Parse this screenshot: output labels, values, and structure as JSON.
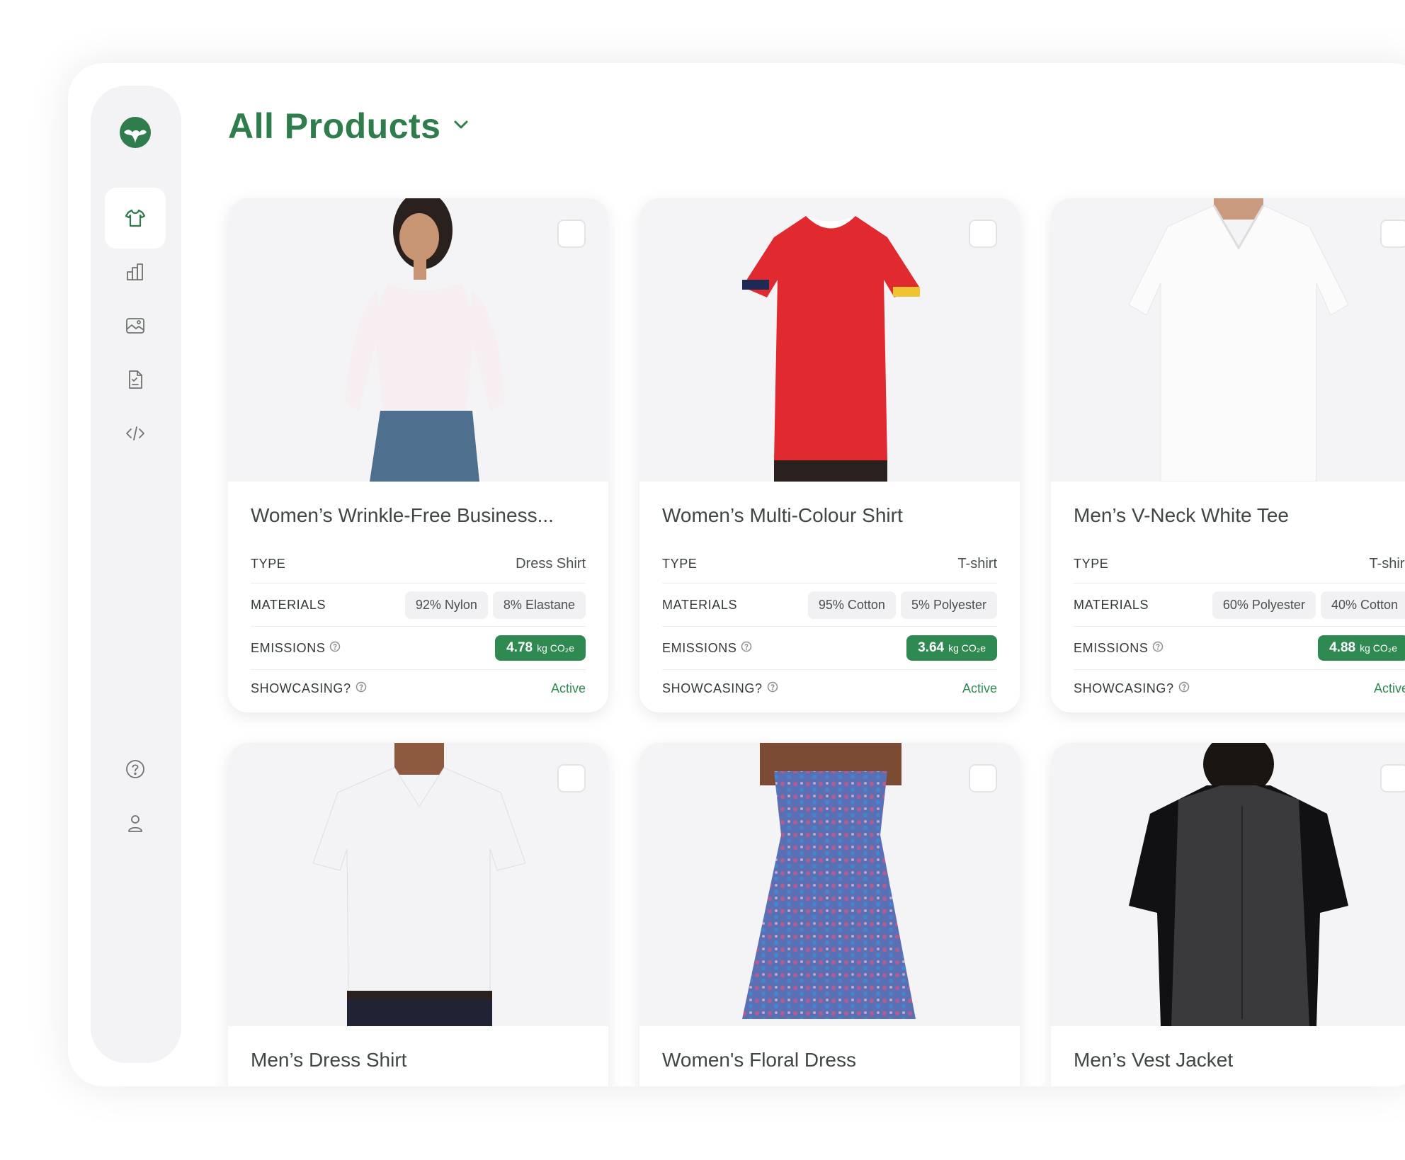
{
  "page": {
    "title": "All Products"
  },
  "sidebar": {
    "items": [
      {
        "name": "products",
        "icon": "tshirt-icon",
        "active": true
      },
      {
        "name": "analytics",
        "icon": "bar-chart-icon",
        "active": false
      },
      {
        "name": "media",
        "icon": "image-icon",
        "active": false
      },
      {
        "name": "reports",
        "icon": "document-icon",
        "active": false
      },
      {
        "name": "developer",
        "icon": "code-icon",
        "active": false
      }
    ],
    "bottom_items": [
      {
        "name": "help",
        "icon": "help-icon"
      },
      {
        "name": "account",
        "icon": "user-icon"
      }
    ]
  },
  "labels": {
    "type": "TYPE",
    "materials": "MATERIALS",
    "emissions": "EMISSIONS",
    "showcasing": "SHOWCASING?"
  },
  "colors": {
    "accent": "#2f7d4d",
    "badge": "#2f8a52",
    "card_bg": "#f4f4f6"
  },
  "products": [
    {
      "name": "Women’s Wrinkle-Free Business...",
      "type": "Dress Shirt",
      "materials": [
        "92% Nylon",
        "8% Elastane"
      ],
      "emissions_value": "4.78",
      "emissions_unit": "kg CO₂e",
      "showcasing": "Active"
    },
    {
      "name": "Women’s Multi-Colour Shirt",
      "type": "T-shirt",
      "materials": [
        "95% Cotton",
        "5% Polyester"
      ],
      "emissions_value": "3.64",
      "emissions_unit": "kg CO₂e",
      "showcasing": "Active"
    },
    {
      "name": "Men’s V-Neck White Tee",
      "type": "T-shirt",
      "materials": [
        "60% Polyester",
        "40% Cotton"
      ],
      "emissions_value": "4.88",
      "emissions_unit": "kg CO₂e",
      "showcasing": "Active"
    },
    {
      "name": "Men’s Dress Shirt"
    },
    {
      "name": "Women's Floral Dress"
    },
    {
      "name": "Men’s Vest Jacket"
    }
  ]
}
